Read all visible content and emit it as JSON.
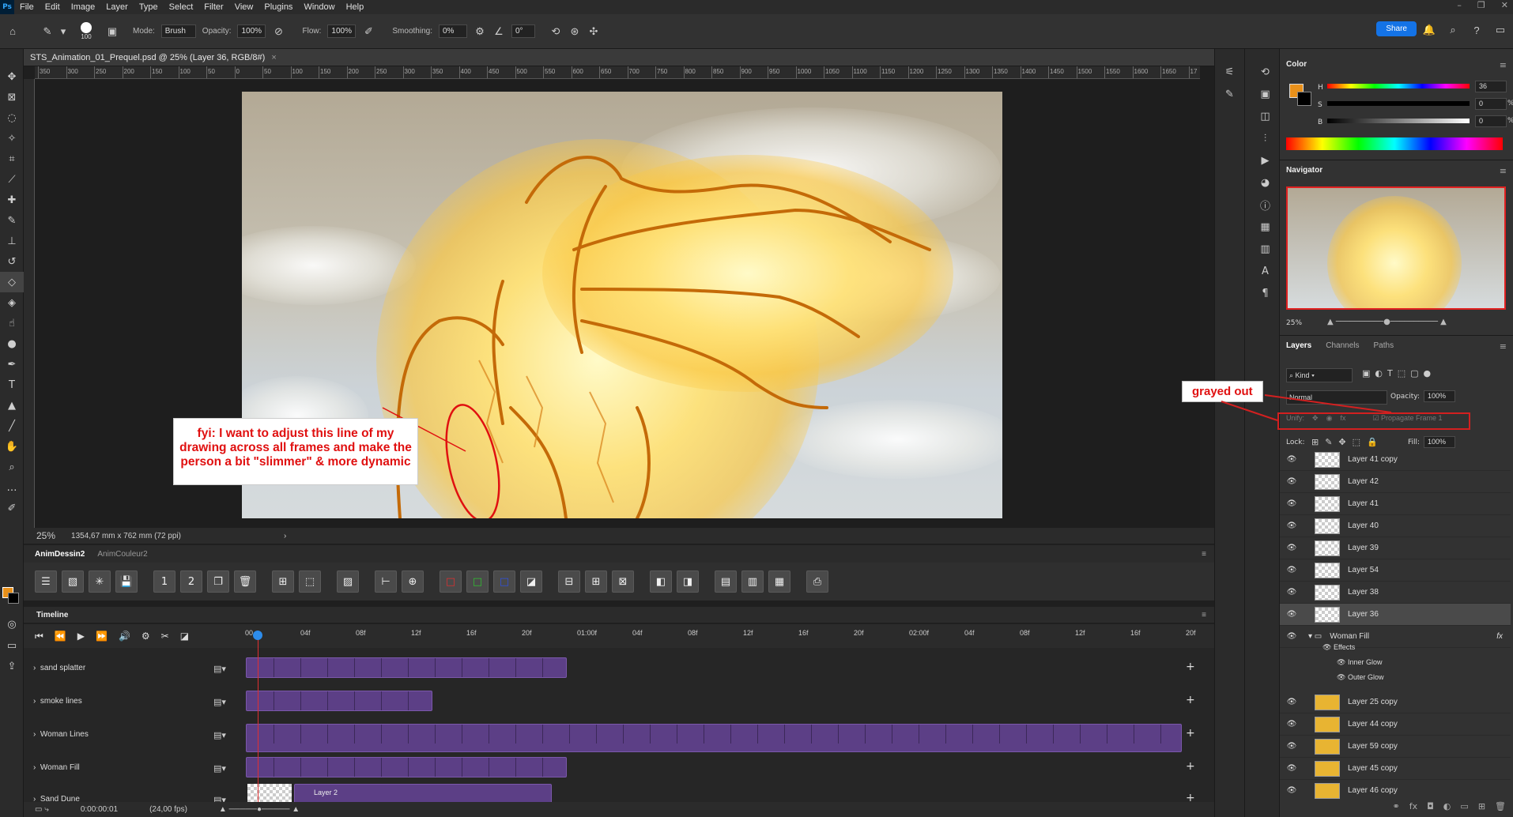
{
  "menu": {
    "logo": "Ps",
    "items": [
      "File",
      "Edit",
      "Image",
      "Layer",
      "Type",
      "Select",
      "Filter",
      "View",
      "Plugins",
      "Window",
      "Help"
    ]
  },
  "options": {
    "brush_size": "100",
    "mode_label": "Mode:",
    "mode_value": "Brush",
    "opacity_label": "Opacity:",
    "opacity_value": "100%",
    "flow_label": "Flow:",
    "flow_value": "100%",
    "smoothing_label": "Smoothing:",
    "smoothing_value": "0%",
    "angle_value": "0°",
    "share_label": "Share"
  },
  "document": {
    "tab_title": "STS_Animation_01_Prequel.psd @ 25% (Layer 36, RGB/8#)",
    "close": "×",
    "zoom": "25%",
    "dimensions": "1354,67 mm x 762 mm (72 ppi)"
  },
  "ruler_labels": [
    "350",
    "300",
    "250",
    "200",
    "150",
    "100",
    "50",
    "0",
    "50",
    "100",
    "150",
    "200",
    "250",
    "300",
    "350",
    "400",
    "450",
    "500",
    "550",
    "600",
    "650",
    "700",
    "750",
    "800",
    "850",
    "900",
    "950",
    "1000",
    "1050",
    "1100",
    "1150",
    "1200",
    "1250",
    "1300",
    "1350",
    "1400",
    "1450",
    "1500",
    "1550",
    "1600",
    "1650",
    "17"
  ],
  "annotation": {
    "text": "fyi: I want to adjust this line of my drawing across all frames and make the person a bit \"slimmer\" & more dynamic"
  },
  "callout": {
    "label": "grayed out"
  },
  "anim_panel": {
    "tabs": [
      "AnimDessin2",
      "AnimCouleur2"
    ]
  },
  "timeline": {
    "title": "Timeline",
    "marks": [
      "00",
      "04f",
      "08f",
      "12f",
      "16f",
      "20f",
      "01:00f",
      "04f",
      "08f",
      "12f",
      "16f",
      "20f",
      "02:00f",
      "04f",
      "08f",
      "12f",
      "16f",
      "20f"
    ],
    "tracks": [
      "sand splatter",
      "smoke lines",
      "Woman Lines",
      "Woman Fill",
      "Sand Dune"
    ],
    "clip_label": "Layer 2",
    "timecode": "0:00:00:01",
    "fps": "(24,00 fps)"
  },
  "color_panel": {
    "title": "Color",
    "h_label": "H",
    "h_value": "36",
    "s_label": "S",
    "s_value": "0",
    "b_label": "B",
    "b_value": "0",
    "unit": "%",
    "fg_color": "#e8901a"
  },
  "navigator": {
    "title": "Navigator",
    "zoom": "25%"
  },
  "layers_panel": {
    "tabs": [
      "Layers",
      "Channels",
      "Paths"
    ],
    "kind_label": "Kind",
    "blend_mode": "Normal",
    "opacity_label": "Opacity:",
    "opacity_value": "100%",
    "unify_label": "Unify:",
    "propagate_label": "Propagate Frame 1",
    "lock_label": "Lock:",
    "fill_label": "Fill:",
    "fill_value": "100%",
    "layers": [
      {
        "name": "Layer 41 copy",
        "thumb": "checker"
      },
      {
        "name": "Layer 42",
        "thumb": "checker"
      },
      {
        "name": "Layer 41",
        "thumb": "checker"
      },
      {
        "name": "Layer 40",
        "thumb": "checker"
      },
      {
        "name": "Layer 39",
        "thumb": "checker"
      },
      {
        "name": "Layer 54",
        "thumb": "checker"
      },
      {
        "name": "Layer 38",
        "thumb": "checker"
      },
      {
        "name": "Layer 36",
        "thumb": "checker",
        "selected": true
      }
    ],
    "group": {
      "name": "Woman Fill",
      "fx": "fx",
      "effects_label": "Effects",
      "effects": [
        "Inner Glow",
        "Outer Glow"
      ]
    },
    "layers_after": [
      {
        "name": "Layer 25 copy",
        "thumb": "gold"
      },
      {
        "name": "Layer 44 copy",
        "thumb": "gold"
      },
      {
        "name": "Layer 59 copy",
        "thumb": "gold"
      },
      {
        "name": "Layer 45 copy",
        "thumb": "gold"
      },
      {
        "name": "Layer 46 copy",
        "thumb": "gold"
      }
    ]
  }
}
